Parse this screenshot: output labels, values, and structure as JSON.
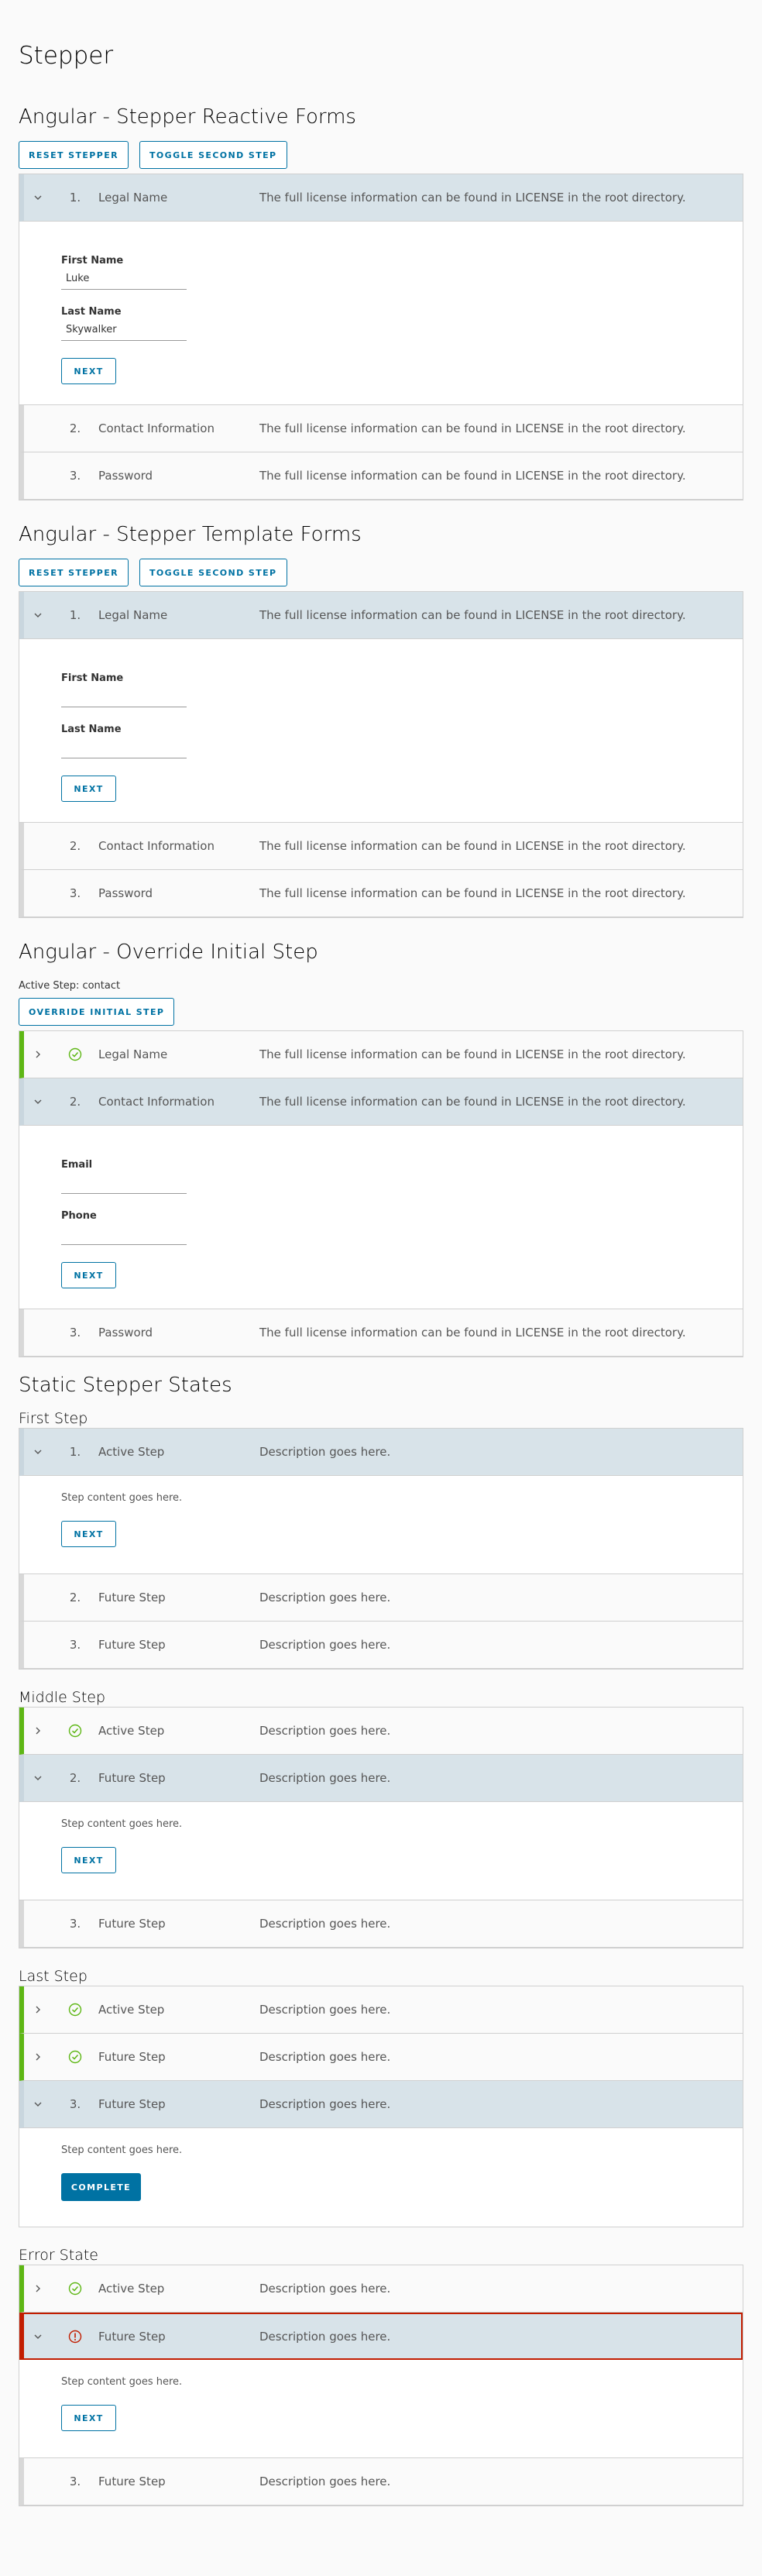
{
  "page": {
    "title": "Stepper"
  },
  "colors": {
    "accent": "#0072a3",
    "complete": "#5eb715",
    "error": "#c21d00",
    "active_header": "#d8e3e9"
  },
  "icons": {
    "chevron_down": "chevron-down-icon",
    "chevron_right": "chevron-right-icon",
    "check": "check-circle-icon",
    "error": "error-circle-icon"
  },
  "reactive": {
    "title": "Angular - Stepper Reactive Forms",
    "reset_label": "RESET STEPPER",
    "toggle_label": "TOGGLE SECOND STEP",
    "steps": [
      {
        "num": "1.",
        "title": "Legal Name",
        "desc": "The full license information can be found in LICENSE in the root directory."
      },
      {
        "num": "2.",
        "title": "Contact Information",
        "desc": "The full license information can be found in LICENSE in the root directory."
      },
      {
        "num": "3.",
        "title": "Password",
        "desc": "The full license information can be found in LICENSE in the root directory."
      }
    ],
    "first_name_label": "First Name",
    "first_name_value": "Luke",
    "last_name_label": "Last Name",
    "last_name_value": "Skywalker",
    "next_label": "NEXT"
  },
  "template": {
    "title": "Angular - Stepper Template Forms",
    "reset_label": "RESET STEPPER",
    "toggle_label": "TOGGLE SECOND STEP",
    "steps": [
      {
        "num": "1.",
        "title": "Legal Name",
        "desc": "The full license information can be found in LICENSE in the root directory."
      },
      {
        "num": "2.",
        "title": "Contact Information",
        "desc": "The full license information can be found in LICENSE in the root directory."
      },
      {
        "num": "3.",
        "title": "Password",
        "desc": "The full license information can be found in LICENSE in the root directory."
      }
    ],
    "first_name_label": "First Name",
    "first_name_value": "",
    "last_name_label": "Last Name",
    "last_name_value": "",
    "next_label": "NEXT"
  },
  "override": {
    "title": "Angular - Override Initial Step",
    "active_step_text": "Active Step: contact",
    "override_label": "OVERRIDE INITIAL STEP",
    "steps": [
      {
        "num": "",
        "title": "Legal Name",
        "desc": "The full license information can be found in LICENSE in the root directory."
      },
      {
        "num": "2.",
        "title": "Contact Information",
        "desc": "The full license information can be found in LICENSE in the root directory."
      },
      {
        "num": "3.",
        "title": "Password",
        "desc": "The full license information can be found in LICENSE in the root directory."
      }
    ],
    "email_label": "Email",
    "email_value": "",
    "phone_label": "Phone",
    "phone_value": "",
    "next_label": "NEXT"
  },
  "static": {
    "title": "Static Stepper States",
    "content_text": "Step content goes here.",
    "next_label": "NEXT",
    "complete_label": "COMPLETE",
    "first": {
      "title": "First Step",
      "steps": [
        {
          "num": "1.",
          "title": "Active Step",
          "desc": "Description goes here."
        },
        {
          "num": "2.",
          "title": "Future Step",
          "desc": "Description goes here."
        },
        {
          "num": "3.",
          "title": "Future Step",
          "desc": "Description goes here."
        }
      ]
    },
    "middle": {
      "title": "Middle Step",
      "steps": [
        {
          "num": "",
          "title": "Active Step",
          "desc": "Description goes here."
        },
        {
          "num": "2.",
          "title": "Future Step",
          "desc": "Description goes here."
        },
        {
          "num": "3.",
          "title": "Future Step",
          "desc": "Description goes here."
        }
      ]
    },
    "last": {
      "title": "Last Step",
      "steps": [
        {
          "num": "",
          "title": "Active Step",
          "desc": "Description goes here."
        },
        {
          "num": "",
          "title": "Future Step",
          "desc": "Description goes here."
        },
        {
          "num": "3.",
          "title": "Future Step",
          "desc": "Description goes here."
        }
      ]
    },
    "error": {
      "title": "Error State",
      "steps": [
        {
          "num": "",
          "title": "Active Step",
          "desc": "Description goes here."
        },
        {
          "num": "",
          "title": "Future Step",
          "desc": "Description goes here."
        },
        {
          "num": "3.",
          "title": "Future Step",
          "desc": "Description goes here."
        }
      ]
    }
  }
}
